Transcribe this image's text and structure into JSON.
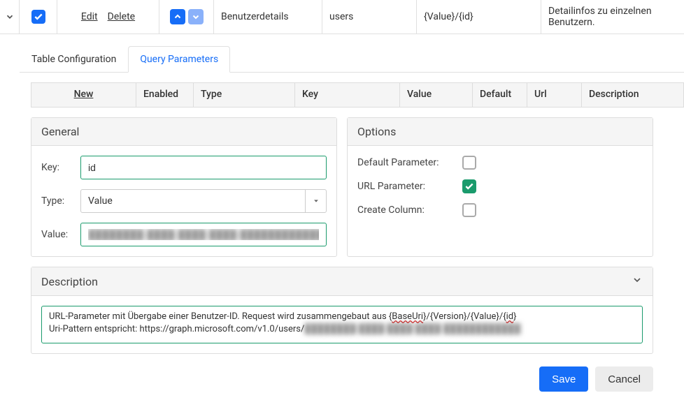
{
  "topRow": {
    "edit": "Edit",
    "delete": "Delete",
    "title": "Benutzerdetails",
    "users": "users",
    "pattern": "{Value}/{id}",
    "description": "Detailinfos zu einzelnen Benutzern."
  },
  "tabs": {
    "tableConfig": "Table Configuration",
    "queryParams": "Query Parameters"
  },
  "tableHeader": {
    "new": "New",
    "enabled": "Enabled",
    "type": "Type",
    "key": "Key",
    "value": "Value",
    "default": "Default",
    "url": "Url",
    "description": "Description"
  },
  "general": {
    "title": "General",
    "keyLabel": "Key:",
    "keyValue": "id",
    "typeLabel": "Type:",
    "typeValue": "Value",
    "valueLabel": "Value:",
    "valueValue": "████████-████-████-████-████████████"
  },
  "options": {
    "title": "Options",
    "defaultParam": "Default Parameter:",
    "urlParam": "URL Parameter:",
    "createColumn": "Create Column:",
    "defaultChecked": false,
    "urlChecked": true,
    "columnChecked": false
  },
  "description": {
    "title": "Description",
    "line1a": "URL-Parameter mit Übergabe einer Benutzer-ID. Request wird zusammengebaut aus {",
    "line1_baseuri": "BaseUri",
    "line1b": "}/{Version}/{Value}/{",
    "line1_id": "id",
    "line1c": "}",
    "line2a": "Uri-Pattern entspricht: https://graph.microsoft.com/v1.0/users/",
    "line2b": "████████-████-████-████-████████████"
  },
  "footer": {
    "save": "Save",
    "cancel": "Cancel"
  }
}
